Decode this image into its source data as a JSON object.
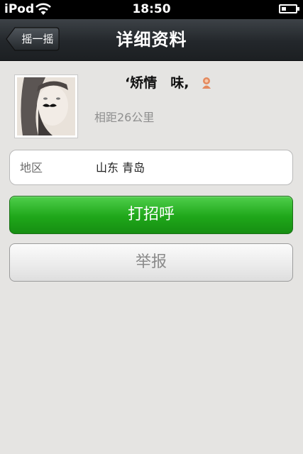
{
  "status_bar": {
    "carrier": "iPod",
    "time": "18:50",
    "battery_level": 0.35
  },
  "nav": {
    "title": "详细资料",
    "back_label": "摇一摇"
  },
  "profile": {
    "nickname": "‘矫情　味,",
    "gender_icon": "female-icon",
    "distance": "相距26公里"
  },
  "region": {
    "label": "地区",
    "value": "山东 青岛"
  },
  "actions": {
    "greet_label": "打招呼",
    "report_label": "举报"
  },
  "colors": {
    "accent_green": "#1fa71a",
    "background": "#e5e4e2",
    "navbar": "#23272b"
  }
}
